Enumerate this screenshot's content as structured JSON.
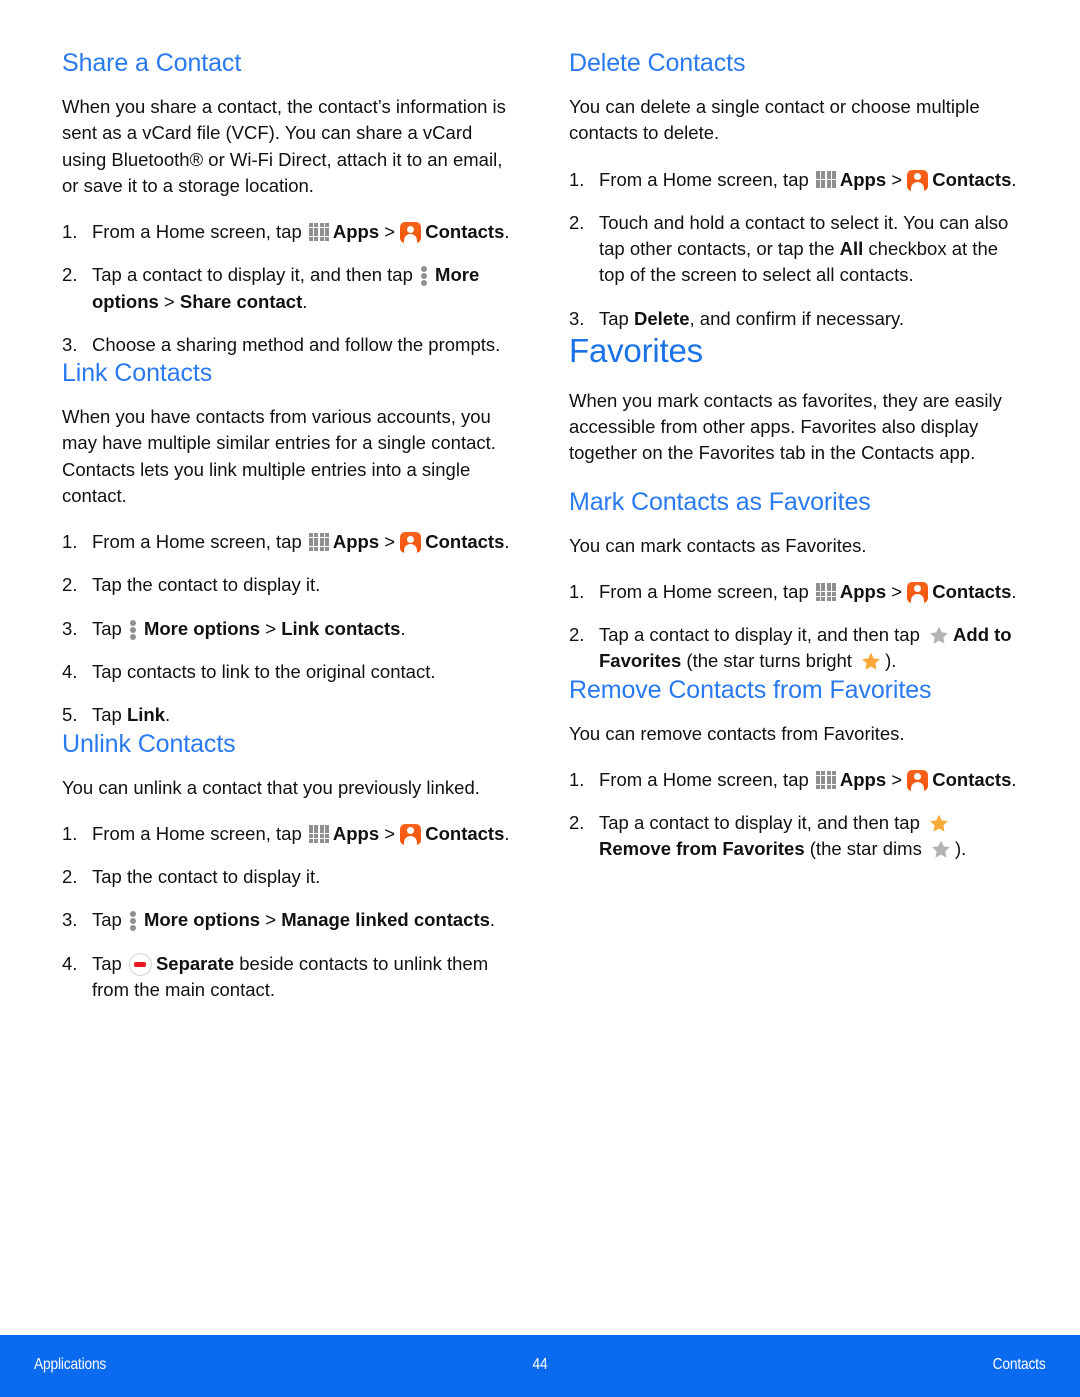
{
  "colors": {
    "heading_blue": "#2979f0",
    "title_blue": "#1a73e8",
    "footer_blue": "#0a6bf0",
    "contacts_icon_orange": "#f2530b",
    "star_bright": "#f9a93a",
    "star_dim": "#b4b4b4",
    "separate_red": "#e8191f",
    "icon_gray": "#8f8f8f"
  },
  "left_column": {
    "share_a_contact": {
      "heading": "Share a Contact",
      "intro": "When you share a contact, the contact’s information is sent as a vCard file (VCF). You can share a vCard using Bluetooth® or Wi-Fi Direct, attach it to an email, or save it to a storage location.",
      "steps": [
        {
          "num": "1.",
          "parts": [
            {
              "type": "text",
              "text": "From a Home screen, tap "
            },
            {
              "type": "icon",
              "icon": "apps-grid-icon"
            },
            {
              "type": "bold",
              "text": "Apps"
            },
            {
              "type": "text",
              "text": " > "
            },
            {
              "type": "icon",
              "icon": "contacts-app-icon"
            },
            {
              "type": "bold",
              "text": "Contacts"
            },
            {
              "type": "text",
              "text": "."
            }
          ]
        },
        {
          "num": "2.",
          "parts": [
            {
              "type": "text",
              "text": "Tap a contact to display it, and then tap "
            },
            {
              "type": "icon",
              "icon": "more-options-icon"
            },
            {
              "type": "bold",
              "text": "More options"
            },
            {
              "type": "text",
              "text": " > "
            },
            {
              "type": "bold",
              "text": "Share contact"
            },
            {
              "type": "text",
              "text": "."
            }
          ]
        },
        {
          "num": "3.",
          "parts": [
            {
              "type": "text",
              "text": "Choose a sharing method and follow the prompts."
            }
          ]
        }
      ]
    },
    "link_contacts": {
      "heading": "Link Contacts",
      "intro": "When you have contacts from various accounts, you may have multiple similar entries for a single contact. Contacts lets you link multiple entries into a single contact.",
      "steps": [
        {
          "num": "1.",
          "parts": [
            {
              "type": "text",
              "text": "From a Home screen, tap "
            },
            {
              "type": "icon",
              "icon": "apps-grid-icon"
            },
            {
              "type": "bold",
              "text": "Apps"
            },
            {
              "type": "text",
              "text": " > "
            },
            {
              "type": "icon",
              "icon": "contacts-app-icon"
            },
            {
              "type": "bold",
              "text": "Contacts"
            },
            {
              "type": "text",
              "text": "."
            }
          ]
        },
        {
          "num": "2.",
          "parts": [
            {
              "type": "text",
              "text": "Tap the contact to display it."
            }
          ]
        },
        {
          "num": "3.",
          "parts": [
            {
              "type": "text",
              "text": "Tap "
            },
            {
              "type": "icon",
              "icon": "more-options-icon"
            },
            {
              "type": "bold",
              "text": "More options"
            },
            {
              "type": "text",
              "text": " > "
            },
            {
              "type": "bold",
              "text": "Link contacts"
            },
            {
              "type": "text",
              "text": "."
            }
          ]
        },
        {
          "num": "4.",
          "parts": [
            {
              "type": "text",
              "text": "Tap contacts to link to the original contact."
            }
          ]
        },
        {
          "num": "5.",
          "parts": [
            {
              "type": "text",
              "text": "Tap "
            },
            {
              "type": "bold",
              "text": "Link"
            },
            {
              "type": "text",
              "text": "."
            }
          ]
        }
      ]
    },
    "unlink_contacts": {
      "heading": "Unlink Contacts",
      "intro": "You can unlink a contact that you previously linked.",
      "steps": [
        {
          "num": "1.",
          "parts": [
            {
              "type": "text",
              "text": "From a Home screen, tap "
            },
            {
              "type": "icon",
              "icon": "apps-grid-icon"
            },
            {
              "type": "bold",
              "text": "Apps"
            },
            {
              "type": "text",
              "text": " > "
            },
            {
              "type": "icon",
              "icon": "contacts-app-icon"
            },
            {
              "type": "bold",
              "text": "Contacts"
            },
            {
              "type": "text",
              "text": "."
            }
          ]
        },
        {
          "num": "2.",
          "parts": [
            {
              "type": "text",
              "text": "Tap the contact to display it."
            }
          ]
        },
        {
          "num": "3.",
          "parts": [
            {
              "type": "text",
              "text": "Tap "
            },
            {
              "type": "icon",
              "icon": "more-options-icon"
            },
            {
              "type": "bold",
              "text": "More options"
            },
            {
              "type": "text",
              "text": " > "
            },
            {
              "type": "bold",
              "text": "Manage linked contacts"
            },
            {
              "type": "text",
              "text": "."
            }
          ]
        },
        {
          "num": "4.",
          "parts": [
            {
              "type": "text",
              "text": "Tap "
            },
            {
              "type": "icon",
              "icon": "separate-minus-icon"
            },
            {
              "type": "bold",
              "text": "Separate"
            },
            {
              "type": "text",
              "text": " beside contacts to unlink them from the main contact."
            }
          ]
        }
      ]
    }
  },
  "right_column": {
    "delete_contacts": {
      "heading": "Delete Contacts",
      "intro": "You can delete a single contact or choose multiple contacts to delete.",
      "steps": [
        {
          "num": "1.",
          "parts": [
            {
              "type": "text",
              "text": "From a Home screen, tap "
            },
            {
              "type": "icon",
              "icon": "apps-grid-icon"
            },
            {
              "type": "bold",
              "text": "Apps"
            },
            {
              "type": "text",
              "text": " > "
            },
            {
              "type": "icon",
              "icon": "contacts-app-icon"
            },
            {
              "type": "bold",
              "text": "Contacts"
            },
            {
              "type": "text",
              "text": "."
            }
          ]
        },
        {
          "num": "2.",
          "parts": [
            {
              "type": "text",
              "text": "Touch and hold a contact to select it. You can also tap other contacts, or tap the "
            },
            {
              "type": "bold",
              "text": "All"
            },
            {
              "type": "text",
              "text": " checkbox at the top of the screen to select all contacts."
            }
          ]
        },
        {
          "num": "3.",
          "parts": [
            {
              "type": "text",
              "text": "Tap "
            },
            {
              "type": "bold",
              "text": "Delete"
            },
            {
              "type": "text",
              "text": ", and confirm if necessary."
            }
          ]
        }
      ]
    },
    "favorites": {
      "heading": "Favorites",
      "intro": "When you mark contacts as favorites, they are easily accessible from other apps. Favorites also display together on the Favorites tab in the Contacts app."
    },
    "mark_contacts_as_favorites": {
      "heading": "Mark Contacts as Favorites",
      "intro": "You can mark contacts as Favorites.",
      "steps": [
        {
          "num": "1.",
          "parts": [
            {
              "type": "text",
              "text": "From a Home screen, tap "
            },
            {
              "type": "icon",
              "icon": "apps-grid-icon"
            },
            {
              "type": "bold",
              "text": "Apps"
            },
            {
              "type": "text",
              "text": " > "
            },
            {
              "type": "icon",
              "icon": "contacts-app-icon"
            },
            {
              "type": "bold",
              "text": "Contacts"
            },
            {
              "type": "text",
              "text": "."
            }
          ]
        },
        {
          "num": "2.",
          "parts": [
            {
              "type": "text",
              "text": "Tap a contact to display it, and then tap "
            },
            {
              "type": "icon",
              "icon": "star-dim-icon"
            },
            {
              "type": "bold",
              "text": "Add to Favorites"
            },
            {
              "type": "text",
              "text": " (the star turns bright "
            },
            {
              "type": "icon",
              "icon": "star-bright-icon"
            },
            {
              "type": "text",
              "text": ")."
            }
          ]
        }
      ]
    },
    "remove_contacts_from_favorites": {
      "heading": "Remove Contacts from Favorites",
      "intro": "You can remove contacts from Favorites.",
      "steps": [
        {
          "num": "1.",
          "parts": [
            {
              "type": "text",
              "text": "From a Home screen, tap "
            },
            {
              "type": "icon",
              "icon": "apps-grid-icon"
            },
            {
              "type": "bold",
              "text": "Apps"
            },
            {
              "type": "text",
              "text": " > "
            },
            {
              "type": "icon",
              "icon": "contacts-app-icon"
            },
            {
              "type": "bold",
              "text": "Contacts"
            },
            {
              "type": "text",
              "text": "."
            }
          ]
        },
        {
          "num": "2.",
          "parts": [
            {
              "type": "text",
              "text": "Tap a contact to display it, and then tap "
            },
            {
              "type": "icon",
              "icon": "star-bright-icon"
            },
            {
              "type": "bold",
              "text": "Remove from Favorites"
            },
            {
              "type": "text",
              "text": " (the star dims "
            },
            {
              "type": "icon",
              "icon": "star-dim-icon"
            },
            {
              "type": "text",
              "text": ")."
            }
          ]
        }
      ]
    }
  },
  "footer": {
    "left": "Applications",
    "page_number": "44",
    "right": "Contacts"
  }
}
